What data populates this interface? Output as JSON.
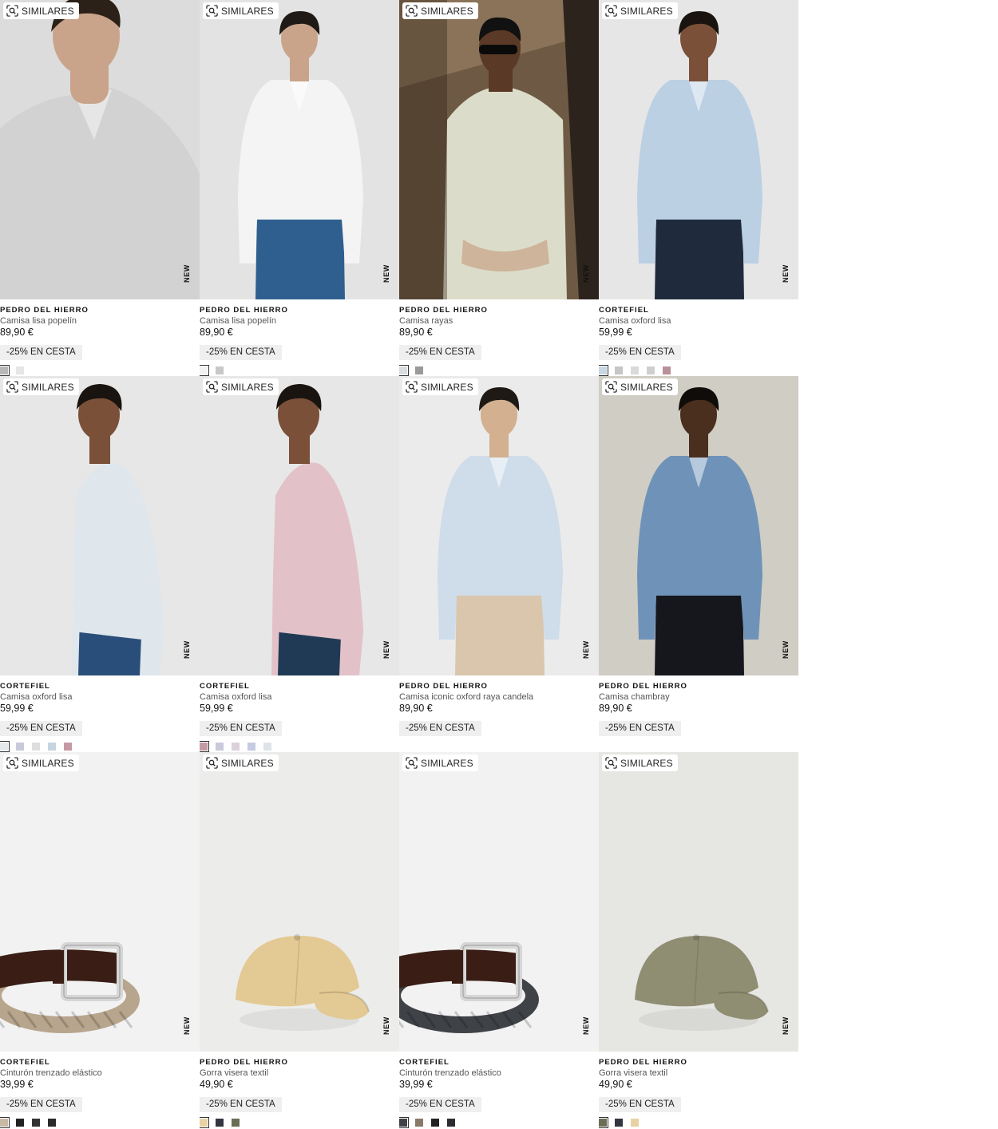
{
  "labels": {
    "similares": "SIMILARES",
    "new": "NEW",
    "promo": "-25% EN CESTA"
  },
  "products": [
    {
      "brand": "PEDRO DEL HIERRO",
      "name": "Camisa lisa popelín",
      "price": "89,90 €",
      "promo": "-25% EN CESTA",
      "image": {
        "bg": "#dcdcdc",
        "figure": "man-shirt-closeup",
        "shirt": "#d2d2d2",
        "skin": "#c9a48a",
        "hair": "#2b2118",
        "pants": "#d2d2d2"
      },
      "swatches": [
        "#b8b8b8",
        "#e6e6e6"
      ],
      "selected": 0
    },
    {
      "brand": "PEDRO DEL HIERRO",
      "name": "Camisa lisa popelín",
      "price": "89,90 €",
      "promo": "-25% EN CESTA",
      "image": {
        "bg": "#e3e3e3",
        "figure": "man-standing",
        "shirt": "#f4f4f4",
        "skin": "#c9a48a",
        "hair": "#1f1a16",
        "pants": "#2f5f8f"
      },
      "swatches": [
        "#f2f2f2",
        "#c8c8c8"
      ],
      "selected": 0
    },
    {
      "brand": "PEDRO DEL HIERRO",
      "name": "Camisa rayas",
      "price": "89,90 €",
      "promo": "-25% EN CESTA",
      "image": {
        "bg": "#6e5a44",
        "figure": "man-wall",
        "shirt": "#dcdcca",
        "skin": "#5a3a26",
        "hair": "#111111",
        "pants": "#1e1e1e"
      },
      "swatches": [
        "#d9dde2",
        "#9a9a9a"
      ],
      "selected": 0
    },
    {
      "brand": "CORTEFIEL",
      "name": "Camisa oxford lisa",
      "price": "59,99 €",
      "promo": "-25% EN CESTA",
      "image": {
        "bg": "#e6e6e6",
        "figure": "man-standing",
        "shirt": "#bcd0e4",
        "skin": "#7a5038",
        "hair": "#1a1410",
        "pants": "#1f2b3d"
      },
      "swatches": [
        "#c9d6e3",
        "#c6c6c6",
        "#dadada",
        "#cfcfcf",
        "#b89098"
      ],
      "selected": 0
    },
    {
      "brand": "CORTEFIEL",
      "name": "Camisa oxford lisa",
      "price": "59,99 €",
      "promo": "-25% EN CESTA",
      "image": {
        "bg": "#e7e7e7",
        "figure": "man-side",
        "shirt": "#dfe6ec",
        "skin": "#7a5038",
        "hair": "#1a1410",
        "pants": "#2a4e7a"
      },
      "swatches": [
        "#e4e9ee",
        "#c8c9d9",
        "#dedede",
        "#c5d4e0",
        "#c49aa3"
      ],
      "selected": 0
    },
    {
      "brand": "CORTEFIEL",
      "name": "Camisa oxford lisa",
      "price": "59,99 €",
      "promo": "-25% EN CESTA",
      "image": {
        "bg": "#e7e7e7",
        "figure": "man-side",
        "shirt": "#e2c2c8",
        "skin": "#7a5038",
        "hair": "#1a1410",
        "pants": "#203a55"
      },
      "swatches": [
        "#c49aa3",
        "#c8c9d9",
        "#dcd0dc",
        "#c5cbe0",
        "#dde4ea"
      ],
      "selected": 0
    },
    {
      "brand": "PEDRO DEL HIERRO",
      "name": "Camisa iconic oxford raya candela",
      "price": "89,90 €",
      "promo": "-25% EN CESTA",
      "image": {
        "bg": "#ebebeb",
        "figure": "man-standing",
        "shirt": "#cfdcea",
        "skin": "#d2b090",
        "hair": "#1e1914",
        "pants": "#d9c6ac"
      },
      "swatches": [],
      "selected": -1
    },
    {
      "brand": "PEDRO DEL HIERRO",
      "name": "Camisa chambray",
      "price": "89,90 €",
      "promo": "-25% EN CESTA",
      "image": {
        "bg": "#cfcdc4",
        "figure": "man-standing",
        "shirt": "#6f93b8",
        "skin": "#4a2e1e",
        "hair": "#0f0c0a",
        "pants": "#15171d"
      },
      "swatches": [],
      "selected": -1
    },
    {
      "brand": "CORTEFIEL",
      "name": "Cinturón trenzado elástico",
      "price": "39,99 €",
      "promo": "-25% EN CESTA",
      "image": {
        "bg": "#f2f2f2",
        "figure": "belt",
        "strap": "#3a1e16",
        "weave": "#b7a58d"
      },
      "swatches": [
        "#c7b9a4",
        "#222222",
        "#333333",
        "#2a2a2a"
      ],
      "selected": 0
    },
    {
      "brand": "PEDRO DEL HIERRO",
      "name": "Gorra visera textil",
      "price": "49,90 €",
      "promo": "-25% EN CESTA",
      "image": {
        "bg": "#ececea",
        "figure": "cap",
        "cap": "#e3c993"
      },
      "swatches": [
        "#e8d2a4",
        "#333640",
        "#6b6e54"
      ],
      "selected": 0
    },
    {
      "brand": "CORTEFIEL",
      "name": "Cinturón trenzado elástico",
      "price": "39,99 €",
      "promo": "-25% EN CESTA",
      "image": {
        "bg": "#f2f2f2",
        "figure": "belt",
        "strap": "#3a1e16",
        "weave": "#3f4247"
      },
      "swatches": [
        "#3f4247",
        "#8a7a6a",
        "#222222",
        "#2b2d33"
      ],
      "selected": 0
    },
    {
      "brand": "PEDRO DEL HIERRO",
      "name": "Gorra visera textil",
      "price": "49,90 €",
      "promo": "-25% EN CESTA",
      "image": {
        "bg": "#e6e6e3",
        "figure": "cap",
        "cap": "#8f8d72"
      },
      "swatches": [
        "#6b6e54",
        "#333640",
        "#e8d2a4"
      ],
      "selected": 0
    }
  ]
}
